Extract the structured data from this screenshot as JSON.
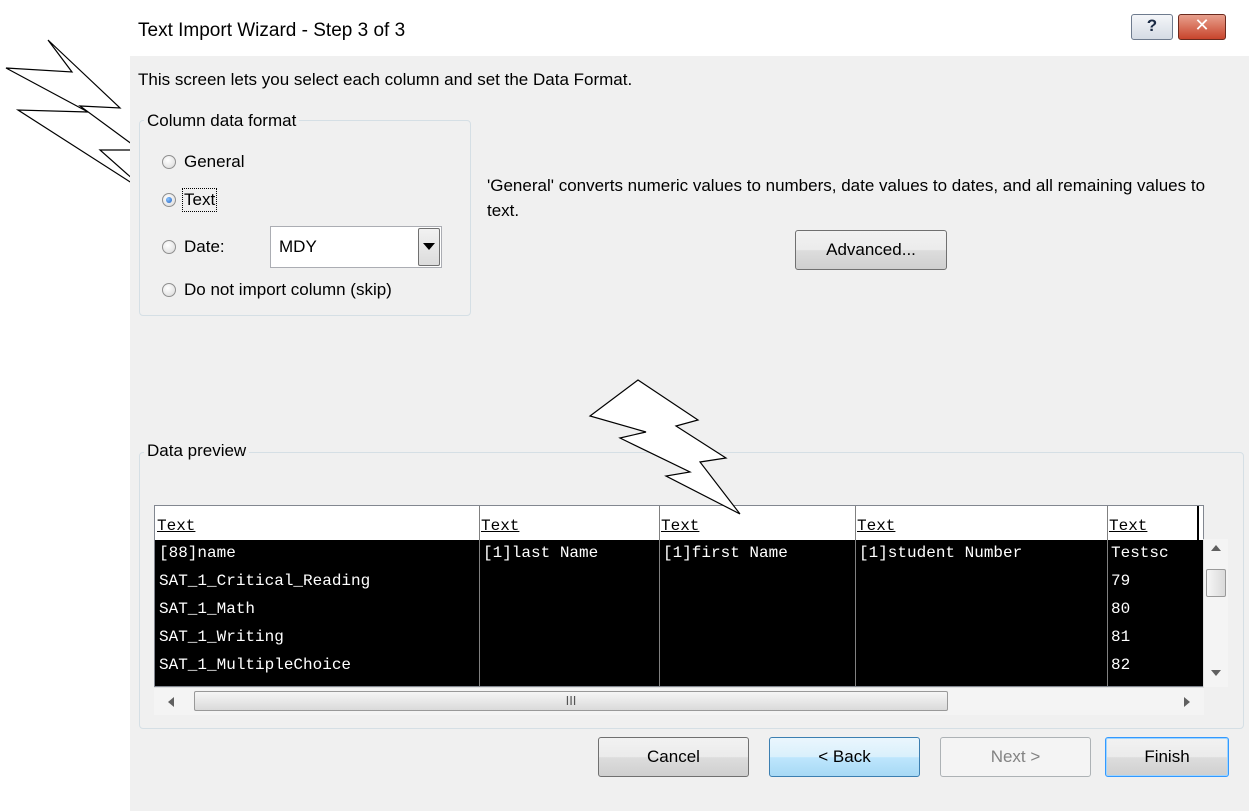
{
  "window": {
    "title": "Text Import Wizard - Step 3 of 3",
    "help_glyph": "?",
    "close_glyph": "✕"
  },
  "instructions": "This screen lets you select each column and set the Data Format.",
  "column_format": {
    "legend": "Column data format",
    "options": [
      {
        "label": "General",
        "selected": false
      },
      {
        "label": "Text",
        "selected": true
      },
      {
        "label": "Date:",
        "selected": false
      },
      {
        "label": "Do not import column (skip)",
        "selected": false
      }
    ],
    "date_value": "MDY"
  },
  "description": "'General' converts numeric values to numbers, date values to dates, and all remaining values to text.",
  "advanced_label": "Advanced...",
  "preview": {
    "legend": "Data preview",
    "headers": [
      "Text",
      "Text",
      "Text",
      "Text",
      "Text"
    ],
    "rows": [
      [
        "[88]name",
        "[1]last Name",
        "[1]first Name",
        "[1]student Number",
        "Testsc"
      ],
      [
        "SAT_1_Critical_Reading",
        "",
        "",
        "",
        "79"
      ],
      [
        "SAT_1_Math",
        "",
        "",
        "",
        "80"
      ],
      [
        "SAT_1_Writing",
        "",
        "",
        "",
        "81"
      ],
      [
        "SAT_1_MultipleChoice",
        "",
        "",
        "",
        "82"
      ]
    ],
    "hscroll_grip": "III"
  },
  "buttons": {
    "cancel": "Cancel",
    "back": "< Back",
    "next": "Next >",
    "finish": "Finish"
  },
  "colors": {
    "dialog_bg": "#f0f0f0",
    "selection_bg": "#000000",
    "selection_text": "#ffffff"
  }
}
